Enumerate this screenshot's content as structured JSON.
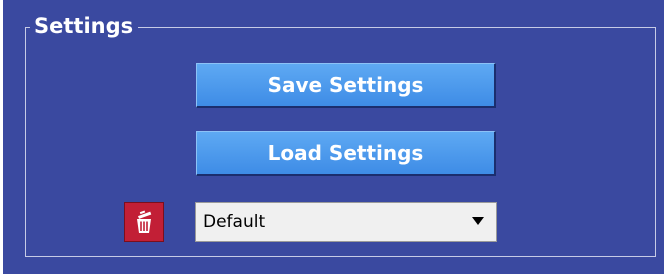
{
  "settings": {
    "group_title": "Settings",
    "save_label": "Save Settings",
    "load_label": "Load Settings",
    "profile_select": {
      "selected": "Default"
    },
    "delete_icon": "trash-icon"
  },
  "colors": {
    "panel_background": "#3a49a0",
    "button_blue": "#4a97ec",
    "delete_red": "#c21f36",
    "select_background": "#f0f0f0"
  }
}
